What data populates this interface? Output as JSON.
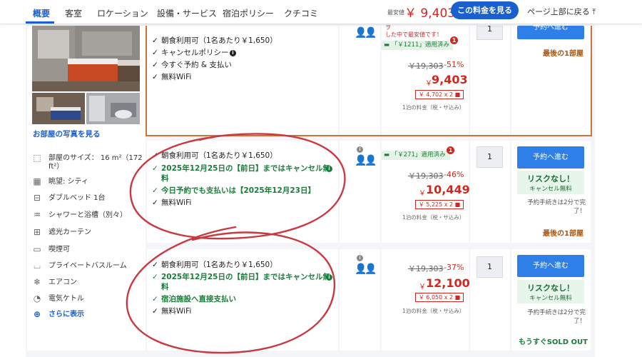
{
  "nav": {
    "tabs": [
      "概要",
      "客室",
      "ロケーション",
      "設備・サービス",
      "宿泊ポリシー",
      "クチコミ"
    ],
    "min_label": "最安値",
    "min_price": "￥ 9,403",
    "cta": "この料金を見る",
    "back_top": "ページ上部に戻る"
  },
  "room": {
    "see_photos": "お部屋の写真を見る",
    "features": [
      "部屋のサイズ： 16 m²（172",
      "ft²）",
      "眺望: シティ",
      "ダブルベッド 1台",
      "シャワーと浴槽（別々）",
      "遮光カーテン",
      "喫煙可",
      "プライベートバスルーム",
      "エアコン",
      "電気ケトル"
    ],
    "show_more": "さらに表示"
  },
  "rates": [
    {
      "options": [
        "朝食利用可（1名あたり￥1,650）",
        "キャンセルポリシー",
        "今すぐ予約 & 支払い",
        "無料WiFi"
      ],
      "warn_line1": "ヲ",
      "warn_line2": "した中で最安値です！",
      "badge": "「￥1211」適用済み",
      "badge_count": "1",
      "old_price": "￥19,303",
      "discount": "-51%",
      "new_price": "9,403",
      "currency": "￥",
      "per_person": "￥ 4,702 x 2",
      "per_night": "1泊の料金（税・サ込み）",
      "qty": "1",
      "book": "予約へ進む",
      "last_room": "最後の1部屋"
    },
    {
      "options": [
        "朝食利用可（1名あたり￥1,650）",
        "2025年12月25日の【前日】まではキャンセル無",
        "料",
        "今日予約でも支払いは【2025年12月23日】",
        "無料WiFi"
      ],
      "badge": "「￥271」適用済み",
      "badge_count": "1",
      "old_price": "￥19,303",
      "discount": "-46%",
      "new_price": "10,449",
      "currency": "￥",
      "per_person": "￥ 5,225 x 2",
      "per_night": "1泊の料金（税・サ込み）",
      "qty": "1",
      "book": "予約へ進む",
      "risk_title": "リスクなし！",
      "risk_sub": "キャンセル無料",
      "proc_line1": "予約手続きは2分で完",
      "proc_line2": "了！",
      "last_room": "最後の1部屋"
    },
    {
      "options": [
        "朝食利用可（1名あたり￥1,650）",
        "2025年12月25日の【前日】まではキャンセル無",
        "料",
        "宿泊施設へ直接支払い",
        "無料WiFi"
      ],
      "old_price": "￥19,303",
      "discount": "-37%",
      "new_price": "12,100",
      "currency": "￥",
      "per_person": "￥ 6,050 x 2",
      "per_night": "1泊の料金（税・サ込み）",
      "qty": "1",
      "book": "予約へ進む",
      "risk_title": "リスクなし！",
      "risk_sub": "キャンセル無料",
      "proc_line1": "予約手続きは2分で完",
      "proc_line2": "了！",
      "soldout": "もうすぐSOLD OUT"
    }
  ],
  "colors": {
    "accent": "#1a5fd0",
    "price_red": "#d0281f",
    "green": "#1b7c3a",
    "annotation_red": "#c9393f"
  }
}
